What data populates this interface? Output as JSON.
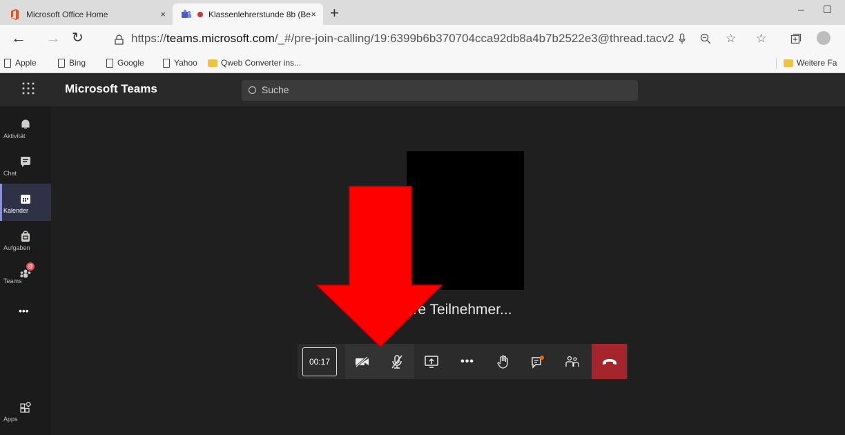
{
  "browser": {
    "tabs": [
      {
        "title": "Microsoft Office Home",
        "close": "×"
      },
      {
        "title": "Klassenlehrerstunde 8b (Be",
        "close": "×"
      }
    ],
    "new_tab": "+",
    "window_minimize": "–",
    "url_prefix": "https://",
    "url_host": "teams.microsoft.com",
    "url_path": "/_#/pre-join-calling/19:6399b6b370704cca92db8a4b7b2522e3@thread.tacv2",
    "bookmarks": [
      "Apple",
      "Bing",
      "Google",
      "Yahoo",
      "Qweb Converter ins..."
    ],
    "other_favorites": "Weitere Fa"
  },
  "teams": {
    "app_name": "Microsoft Teams",
    "search_placeholder": "Suche",
    "rail": [
      {
        "label": "Aktivität",
        "icon": "bell-icon"
      },
      {
        "label": "Chat",
        "icon": "chat-icon"
      },
      {
        "label": "Kalender",
        "icon": "calendar-icon",
        "active": true
      },
      {
        "label": "Aufgaben",
        "icon": "bag-icon"
      },
      {
        "label": "Teams",
        "icon": "teams-icon"
      },
      {
        "label": "•••",
        "icon": "more-icon"
      },
      {
        "label": "Apps",
        "icon": "apps-icon"
      }
    ],
    "waiting_text": "uf weitere Teilnehmer...",
    "call_timer": "00:17",
    "call_controls": [
      "camera-off-icon",
      "mic-off-icon",
      "share-screen-icon",
      "more-actions-icon",
      "raise-hand-icon",
      "chat-icon",
      "participants-icon",
      "hang-up-icon"
    ]
  },
  "colors": {
    "accent": "#8b8fd6",
    "hangup": "#a4262c",
    "arrow": "#ff0000"
  }
}
